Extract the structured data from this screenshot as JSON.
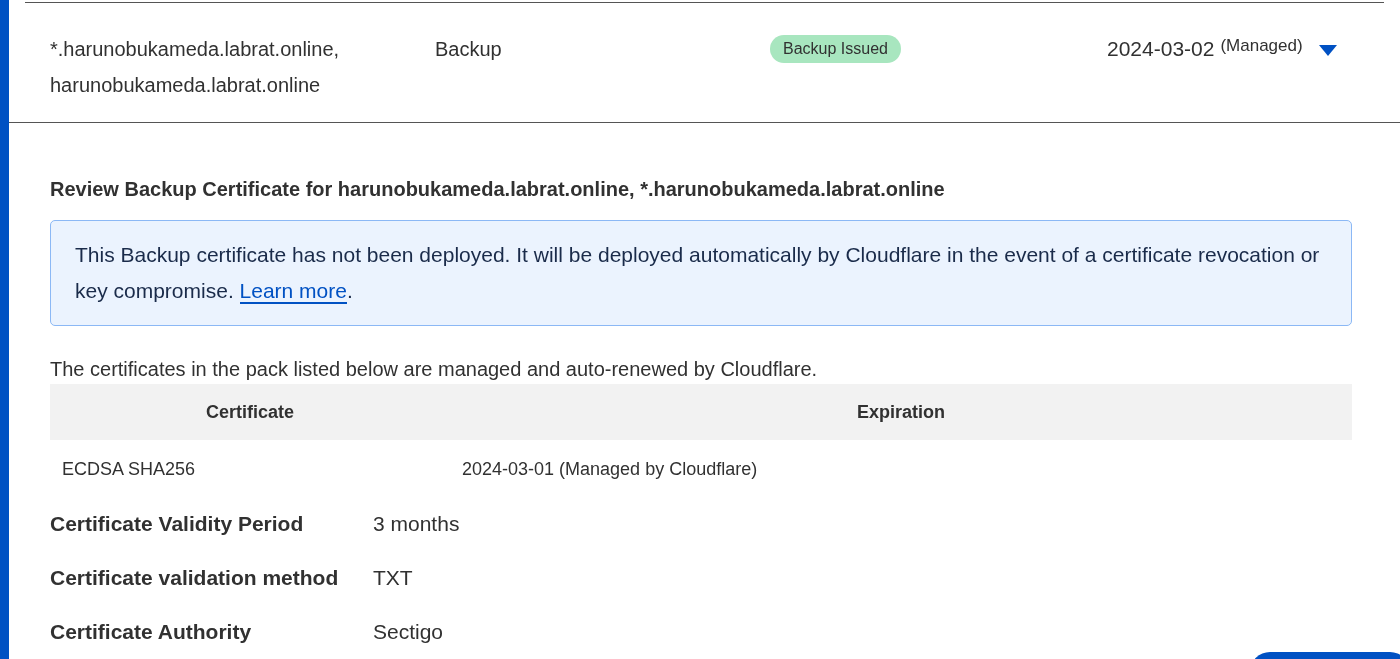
{
  "row": {
    "hostnames": [
      "*.harunobukameda.labrat.online,",
      "harunobukameda.labrat.online"
    ],
    "type": "Backup",
    "status": "Backup Issued",
    "expires": "2024-03-02",
    "expires_note": "(Managed)",
    "expanded": true
  },
  "detail": {
    "title": "Review Backup Certificate for harunobukameda.labrat.online, *.harunobukameda.labrat.online",
    "notice": {
      "text": "This Backup certificate has not been deployed. It will be deployed automatically by Cloudflare in the event of a certificate revocation or key compromise.",
      "link": "Learn more",
      "after_link": "."
    },
    "intro": "The certificates in the pack listed below are managed and auto-renewed by Cloudflare.",
    "table": {
      "columns": [
        "Certificate",
        "Expiration"
      ],
      "rows": [
        [
          "ECDSA SHA256",
          "2024-03-01 (Managed by Cloudflare)"
        ]
      ]
    },
    "properties": [
      {
        "label": "Certificate Validity Period",
        "value": "3 months"
      },
      {
        "label": "Certificate validation method",
        "value": "TXT"
      },
      {
        "label": "Certificate Authority",
        "value": "Sectigo"
      }
    ]
  }
}
